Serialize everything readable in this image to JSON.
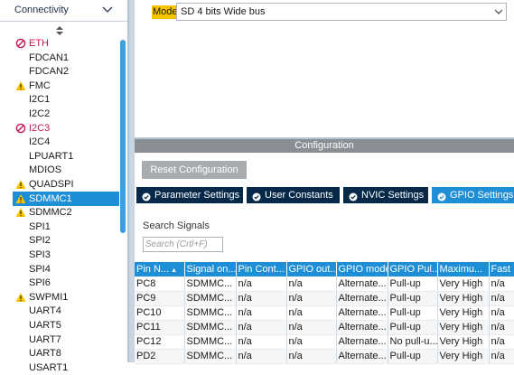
{
  "category": {
    "title": "Connectivity",
    "chevron_icon": "chevron-down-icon"
  },
  "peripherals": [
    {
      "label": "ETH",
      "status": "disabled"
    },
    {
      "label": "FDCAN1",
      "status": "normal"
    },
    {
      "label": "FDCAN2",
      "status": "normal"
    },
    {
      "label": "FMC",
      "status": "warning"
    },
    {
      "label": "I2C1",
      "status": "normal"
    },
    {
      "label": "I2C2",
      "status": "normal"
    },
    {
      "label": "I2C3",
      "status": "disabled"
    },
    {
      "label": "I2C4",
      "status": "normal"
    },
    {
      "label": "LPUART1",
      "status": "normal"
    },
    {
      "label": "MDIOS",
      "status": "normal"
    },
    {
      "label": "QUADSPI",
      "status": "warning"
    },
    {
      "label": "SDMMC1",
      "status": "selected-warning"
    },
    {
      "label": "SDMMC2",
      "status": "warning"
    },
    {
      "label": "SPI1",
      "status": "normal"
    },
    {
      "label": "SPI2",
      "status": "normal"
    },
    {
      "label": "SPI3",
      "status": "normal"
    },
    {
      "label": "SPI4",
      "status": "normal"
    },
    {
      "label": "SPI6",
      "status": "normal"
    },
    {
      "label": "SWPMI1",
      "status": "warning"
    },
    {
      "label": "UART4",
      "status": "normal"
    },
    {
      "label": "UART5",
      "status": "normal"
    },
    {
      "label": "UART7",
      "status": "normal"
    },
    {
      "label": "UART8",
      "status": "normal"
    },
    {
      "label": "USART1",
      "status": "normal"
    }
  ],
  "mode": {
    "label": "Mode",
    "value": "SD 4 bits Wide bus"
  },
  "configuration": {
    "title": "Configuration",
    "reset_label": "Reset Configuration",
    "tabs": [
      {
        "label": "Parameter Settings",
        "active": false
      },
      {
        "label": "User Constants",
        "active": false
      },
      {
        "label": "NVIC Settings",
        "active": false
      },
      {
        "label": "GPIO Settings",
        "active": true
      }
    ],
    "search_label": "Search Signals",
    "search_placeholder": "Search (Crtl+F)"
  },
  "pin_table": {
    "columns": [
      "Pin N...",
      "Signal on...",
      "Pin Cont...",
      "GPIO out...",
      "GPIO mode",
      "GPIO Pul...",
      "Maximu...",
      "Fast"
    ],
    "rows": [
      [
        "PC8",
        "SDMMC...",
        "n/a",
        "n/a",
        "Alternate...",
        "Pull-up",
        "Very High",
        "n/a"
      ],
      [
        "PC9",
        "SDMMC...",
        "n/a",
        "n/a",
        "Alternate...",
        "Pull-up",
        "Very High",
        "n/a"
      ],
      [
        "PC10",
        "SDMMC...",
        "n/a",
        "n/a",
        "Alternate...",
        "Pull-up",
        "Very High",
        "n/a"
      ],
      [
        "PC11",
        "SDMMC...",
        "n/a",
        "n/a",
        "Alternate...",
        "Pull-up",
        "Very High",
        "n/a"
      ],
      [
        "PC12",
        "SDMMC...",
        "n/a",
        "n/a",
        "Alternate...",
        "No pull-u...",
        "Very High",
        "n/a"
      ],
      [
        "PD2",
        "SDMMC...",
        "n/a",
        "n/a",
        "Alternate...",
        "Pull-up",
        "Very High",
        "n/a"
      ]
    ]
  },
  "colors": {
    "selection_blue": "#1e8fd6",
    "tab_dark": "#06294a",
    "mode_highlight": "#f5c400",
    "disabled_pink": "#c2185b",
    "warning_yellow": "#f5c400"
  }
}
